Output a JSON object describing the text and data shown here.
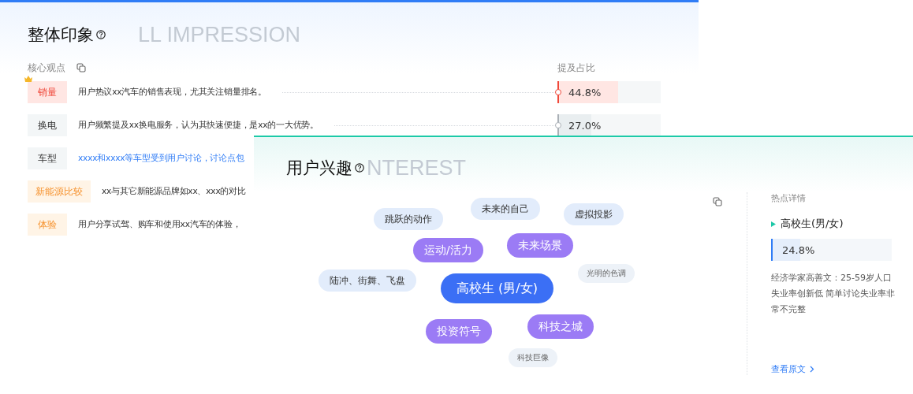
{
  "overall": {
    "title": "整体印象",
    "ghost_title": "LL IMPRESSION",
    "column_1": "核心观点",
    "column_2": "提及占比",
    "rows": [
      {
        "tag": "销量",
        "kind": "hot",
        "crown": true,
        "text": "用户热议xx汽车的销售表现，尤其关注销量排名。",
        "highlighted": false,
        "share": "44.8%",
        "level": 0.58
      },
      {
        "tag": "换电",
        "kind": "normal",
        "crown": false,
        "text": "用户频繁提及xx换电服务，认为其快速便捷，是xx的一大优势。",
        "highlighted": false,
        "share": "27.0%",
        "level": 0.32
      },
      {
        "tag": "车型",
        "kind": "normal",
        "crown": false,
        "text": "xxxx和xxxx等车型受到用户讨论，讨论点包",
        "highlighted": true
      },
      {
        "tag": "新能源比较",
        "kind": "warm",
        "crown": false,
        "text": "xx与其它新能源品牌如xx、xxx的对比",
        "highlighted": false
      },
      {
        "tag": "体验",
        "kind": "warm",
        "crown": false,
        "text": "用户分享试驾、购车和使用xx汽车的体验，",
        "highlighted": false
      }
    ]
  },
  "interest": {
    "title": "用户兴趣",
    "ghost_title": "NTEREST",
    "bubbles": [
      {
        "label": "跳跃的动作",
        "kind": "light"
      },
      {
        "label": "未来的自己",
        "kind": "light"
      },
      {
        "label": "虚拟投影",
        "kind": "light"
      },
      {
        "label": "运动/活力",
        "kind": "strong"
      },
      {
        "label": "未来场景",
        "kind": "strong"
      },
      {
        "label": "陆冲、街舞、飞盘",
        "kind": "light"
      },
      {
        "label": "高校生 (男/女)",
        "kind": "main"
      },
      {
        "label": "光明的色调",
        "kind": "small"
      },
      {
        "label": "投资符号",
        "kind": "strong"
      },
      {
        "label": "科技之城",
        "kind": "strong"
      },
      {
        "label": "科技巨像",
        "kind": "small"
      }
    ],
    "detail": {
      "heading": "热点详情",
      "name": "高校生(男/女)",
      "share": "24.8%",
      "level": 0.23,
      "description": "经济学家高善文：25-59岁人口失业率创新低 简单讨论失业率非常不完整",
      "link": "查看原文"
    }
  }
}
